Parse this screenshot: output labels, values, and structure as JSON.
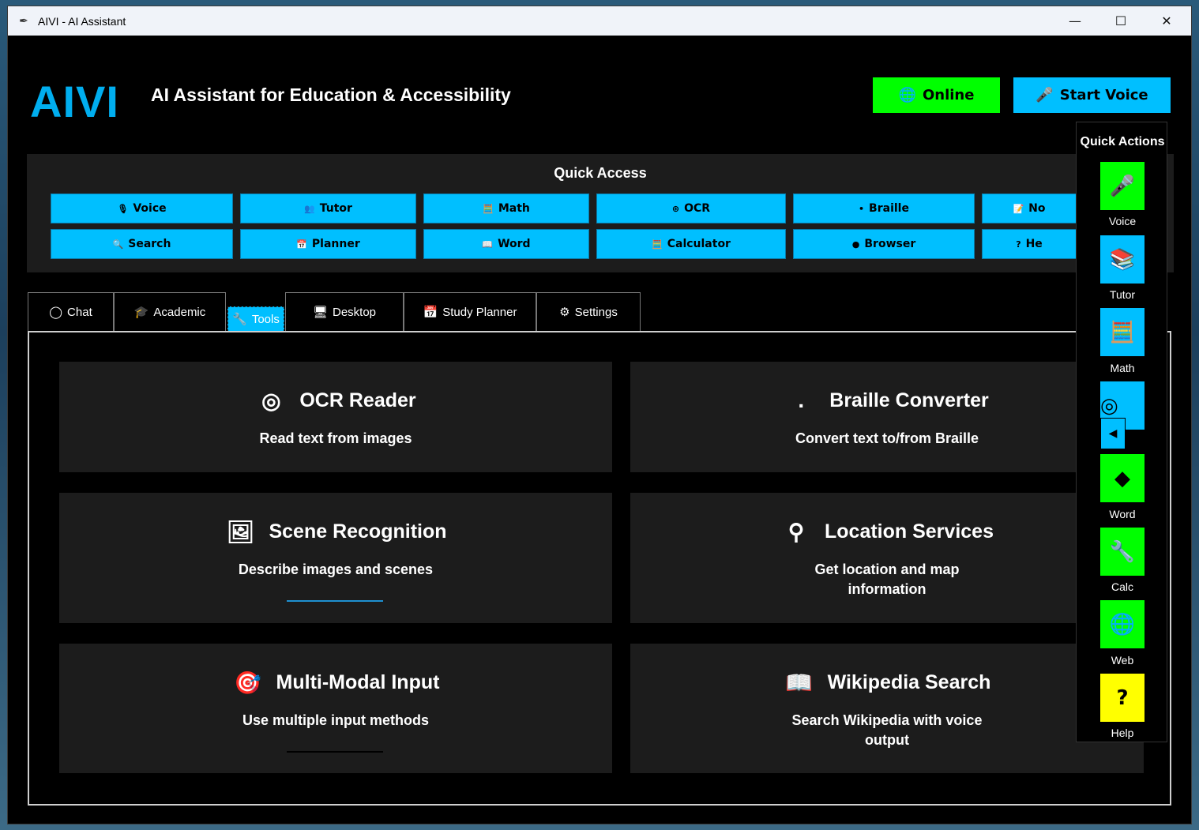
{
  "window": {
    "title": "AIVI - AI Assistant",
    "controls": {
      "minimize": "—",
      "maximize": "☐",
      "close": "✕"
    }
  },
  "header": {
    "logo": "AIVI",
    "subtitle": "AI Assistant for Education & Accessibility",
    "online_label": "Online",
    "start_voice_label": "Start Voice"
  },
  "quick_access": {
    "title": "Quick Access",
    "row1": [
      {
        "icon": "🎙",
        "label": "Voice"
      },
      {
        "icon": "👥",
        "label": "Tutor"
      },
      {
        "icon": "🧮",
        "label": "Math"
      },
      {
        "icon": "⊛",
        "label": "OCR"
      },
      {
        "icon": "•",
        "label": "Braille"
      },
      {
        "icon": "📝",
        "label": "No"
      }
    ],
    "row2": [
      {
        "icon": "🔍",
        "label": "Search"
      },
      {
        "icon": "📅",
        "label": "Planner"
      },
      {
        "icon": "📖",
        "label": "Word"
      },
      {
        "icon": "🧮",
        "label": "Calculator"
      },
      {
        "icon": "●",
        "label": "Browser"
      },
      {
        "icon": "?",
        "label": "He"
      }
    ]
  },
  "tabs": [
    {
      "icon": "◯",
      "label": "Chat"
    },
    {
      "icon": "🎓",
      "label": "Academic"
    },
    {
      "icon": "🔧",
      "label": "Tools"
    },
    {
      "icon": "🖥",
      "label": "Desktop"
    },
    {
      "icon": "📅",
      "label": "Study Planner"
    },
    {
      "icon": "⚙",
      "label": "Settings"
    }
  ],
  "cards": [
    {
      "title": "OCR Reader",
      "desc": "Read text from images",
      "icon": "◎"
    },
    {
      "title": "Braille Converter",
      "desc": "Convert text to/from Braille",
      "icon": "."
    },
    {
      "title": "Scene Recognition",
      "desc": "Describe images and scenes",
      "icon": "🖼"
    },
    {
      "title": "Location Services",
      "desc": "Get location and map information",
      "icon": "⚲"
    },
    {
      "title": "Multi-Modal Input",
      "desc": "Use multiple input methods",
      "icon": "🎯"
    },
    {
      "title": "Wikipedia Search",
      "desc": "Search Wikipedia with voice output",
      "icon": "📖"
    }
  ],
  "quick_actions": {
    "title": "Quick Actions",
    "items": [
      {
        "label": "Voice",
        "icon": "🎤",
        "color": "#00ff00"
      },
      {
        "label": "Tutor",
        "icon": "📚",
        "color": "#00bfff"
      },
      {
        "label": "Math",
        "icon": "🧮",
        "color": "#00bfff"
      },
      {
        "label": "",
        "icon": "◎",
        "color": "#00bfff"
      },
      {
        "label": "Word",
        "icon": "◆",
        "color": "#00ff00"
      },
      {
        "label": "Calc",
        "icon": "🔧",
        "color": "#00ff00"
      },
      {
        "label": "Web",
        "icon": "🌐",
        "color": "#00ff00"
      },
      {
        "label": "Help",
        "icon": "?",
        "color": "#ffff00"
      }
    ],
    "overlay_icon": "◀"
  },
  "colors": {
    "accent_blue": "#00bfff",
    "online_green": "#00ff00",
    "help_yellow": "#ffff00",
    "logo_blue": "#00aeef"
  }
}
